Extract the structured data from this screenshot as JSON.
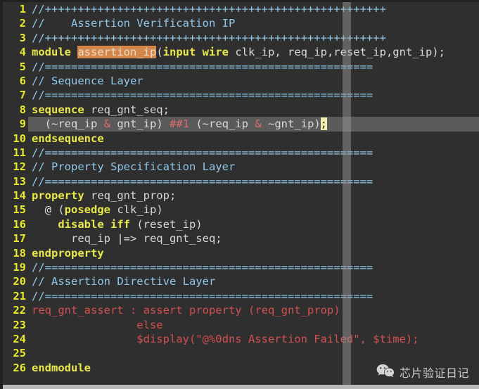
{
  "editor": {
    "language": "SystemVerilog",
    "background_color": "#2f2f2f",
    "gutter_color": "#e8e82a",
    "selection_color": "#d4874a",
    "current_line_color": "#5a5a5a",
    "cursor_color": "#f2f0b0",
    "comment_color": "#8fc7e8",
    "keyword_color": "#e8e84a",
    "plain_color": "#d8d8d8",
    "assert_color": "#d2504f"
  },
  "lines": [
    {
      "num": "1",
      "text": "//++++++++++++++++++++++++++++++++++++++++++++++++++++"
    },
    {
      "num": "2",
      "text": "//    Assertion Verification IP"
    },
    {
      "num": "3",
      "text": "//++++++++++++++++++++++++++++++++++++++++++++++++++++"
    },
    {
      "num": "4",
      "text": "module assertion_ip(input wire clk_ip, req_ip,reset_ip,gnt_ip);"
    },
    {
      "num": "5",
      "text": "//=================================================="
    },
    {
      "num": "6",
      "text": "// Sequence Layer"
    },
    {
      "num": "7",
      "text": "//=================================================="
    },
    {
      "num": "8",
      "text": "sequence req_gnt_seq;"
    },
    {
      "num": "9",
      "text": "  (~req_ip & gnt_ip) ##1 (~req_ip & ~gnt_ip);"
    },
    {
      "num": "10",
      "text": "endsequence"
    },
    {
      "num": "11",
      "text": "//=================================================="
    },
    {
      "num": "12",
      "text": "// Property Specification Layer"
    },
    {
      "num": "13",
      "text": "//=================================================="
    },
    {
      "num": "14",
      "text": "property req_gnt_prop;"
    },
    {
      "num": "15",
      "text": "  @ (posedge clk_ip)"
    },
    {
      "num": "16",
      "text": "    disable iff (reset_ip)"
    },
    {
      "num": "17",
      "text": "      req_ip |=> req_gnt_seq;"
    },
    {
      "num": "18",
      "text": "endproperty"
    },
    {
      "num": "19",
      "text": "//=================================================="
    },
    {
      "num": "20",
      "text": "// Assertion Directive Layer"
    },
    {
      "num": "21",
      "text": "//=================================================="
    },
    {
      "num": "22",
      "text": "req_gnt_assert : assert property (req_gnt_prop)"
    },
    {
      "num": "23",
      "text": "                else"
    },
    {
      "num": "24",
      "text": "                $display(\"@%0dns Assertion Failed\", $time);"
    },
    {
      "num": "25",
      "text": ""
    },
    {
      "num": "26",
      "text": "endmodule"
    }
  ],
  "selection": {
    "line": "4",
    "text": "assertion_ip"
  },
  "cursor": {
    "line": "9",
    "char": ";"
  },
  "watermark": {
    "icon": "wechat-icon",
    "text": "芯片验证日记"
  }
}
